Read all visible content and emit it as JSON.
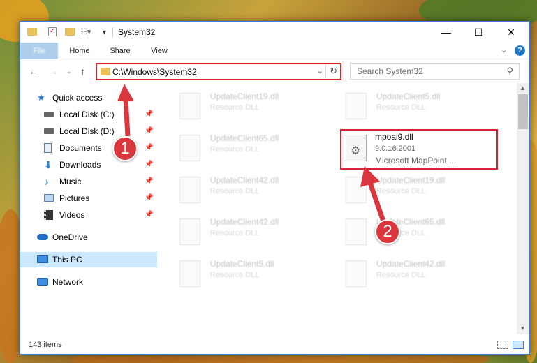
{
  "window": {
    "title": "System32",
    "status": "143 items"
  },
  "ribbon": {
    "tabs": [
      "File",
      "Home",
      "Share",
      "View"
    ]
  },
  "address": {
    "path": "C:\\Windows\\System32"
  },
  "search": {
    "placeholder": "Search System32"
  },
  "sidebar": {
    "items": [
      {
        "label": "Quick access",
        "icon": "star-icon"
      },
      {
        "label": "Local Disk (C:)",
        "icon": "drive-icon",
        "pinned": true
      },
      {
        "label": "Local Disk (D:)",
        "icon": "drive-icon",
        "pinned": true
      },
      {
        "label": "Documents",
        "icon": "documents-icon",
        "pinned": true
      },
      {
        "label": "Downloads",
        "icon": "downloads-icon",
        "pinned": true
      },
      {
        "label": "Music",
        "icon": "music-icon",
        "pinned": true
      },
      {
        "label": "Pictures",
        "icon": "pictures-icon",
        "pinned": true
      },
      {
        "label": "Videos",
        "icon": "videos-icon",
        "pinned": true
      },
      {
        "label": "OneDrive",
        "icon": "cloud-icon"
      },
      {
        "label": "This PC",
        "icon": "pc-icon",
        "selected": true
      },
      {
        "label": "Network",
        "icon": "network-icon"
      }
    ]
  },
  "files": [
    {
      "name": "UpdateClient19.dll",
      "type": "Resource DLL"
    },
    {
      "name": "UpdateClient5.dll",
      "type": "Resource DLL"
    },
    {
      "name": "UpdateClient65.dll",
      "type": "Resource DLL"
    },
    {
      "name": "mpoai9.dll",
      "version": "9.0.16.2001",
      "type": "Microsoft MapPoint ...",
      "highlighted": true
    },
    {
      "name": "UpdateClient42.dll",
      "type": "Resource DLL"
    },
    {
      "name": "UpdateClient19.dll",
      "type": "Resource DLL"
    },
    {
      "name": "UpdateClient42.dll",
      "type": "Resource DLL"
    },
    {
      "name": "UpdateClient65.dll",
      "type": "Resource DLL"
    },
    {
      "name": "UpdateClient5.dll",
      "type": "Resource DLL"
    },
    {
      "name": "UpdateClient42.dll",
      "type": "Resource DLL"
    }
  ],
  "callouts": [
    "1",
    "2"
  ],
  "colors": {
    "accent": "#1979ca",
    "highlight": "#d9232d",
    "callout": "#d9363e"
  }
}
